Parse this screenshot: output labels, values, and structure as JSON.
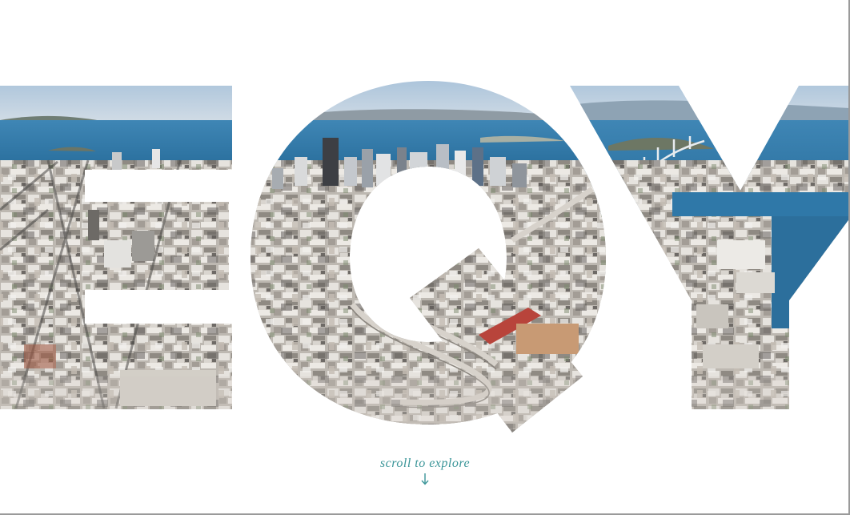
{
  "hero": {
    "letters": [
      "E",
      "Q",
      "Y"
    ],
    "fill_image": "aerial-city-photo",
    "colors": {
      "sky": "#b9cfe2",
      "bay": "#2f78a8",
      "hills": "#6f7d74",
      "city_light": "#d9d6d0",
      "city_mid": "#a9a49c",
      "city_dark": "#5d5a57",
      "freeway": "#cfcac3",
      "roof_red": "#b8443b"
    }
  },
  "scroll_cta": {
    "label": "scroll to explore",
    "icon": "arrow-down-icon",
    "color": "#3a9598"
  }
}
